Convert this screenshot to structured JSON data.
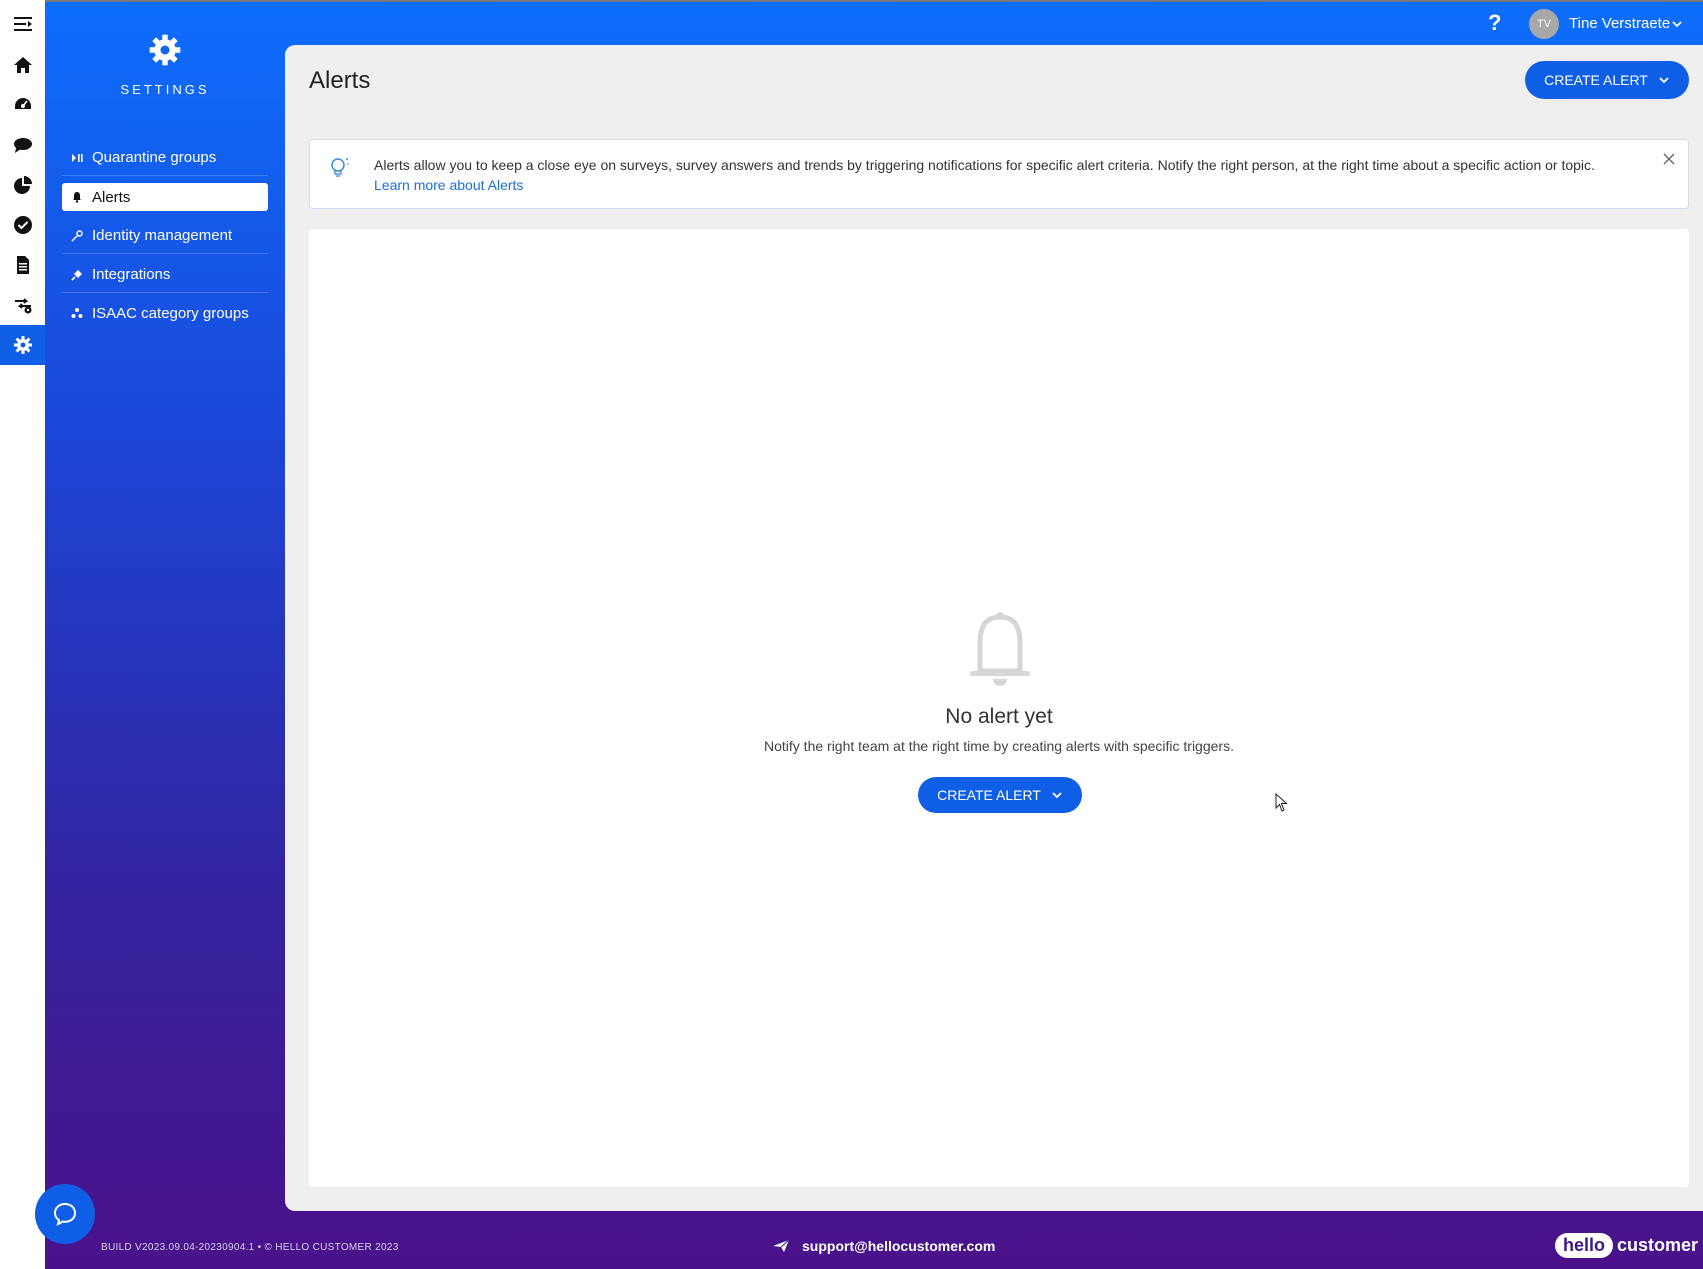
{
  "app": {
    "section_title": "SETTINGS"
  },
  "rail": {
    "items": [
      "menu-toggle",
      "home",
      "dashboard",
      "conversations",
      "reports",
      "tasks",
      "documents",
      "workflow",
      "settings"
    ]
  },
  "sidebar": {
    "items": [
      {
        "label": "Quarantine groups",
        "icon": "pause-play-icon"
      },
      {
        "label": "Alerts",
        "icon": "bell-icon",
        "active": true
      },
      {
        "label": "Identity management",
        "icon": "key-icon"
      },
      {
        "label": "Integrations",
        "icon": "plug-icon"
      },
      {
        "label": "ISAAC category groups",
        "icon": "group-icon"
      }
    ]
  },
  "header": {
    "help": "?",
    "avatar_initials": "TV",
    "user_name": "Tine Verstraete"
  },
  "main": {
    "title": "Alerts",
    "create_label": "CREATE ALERT",
    "banner": {
      "text": "Alerts allow you to keep a close eye on surveys, survey answers and trends by triggering notifications for specific alert criteria. Notify the right person, at the right time about a specific action or topic.",
      "link": "Learn more about Alerts"
    },
    "empty": {
      "title": "No alert yet",
      "subtitle": "Notify the right team at the right time by creating alerts with specific triggers.",
      "button_label": "CREATE ALERT"
    }
  },
  "footer": {
    "build": "BUILD V2023.09.04-20230904.1 • © HELLO CUSTOMER 2023",
    "support_email": "support@hellocustomer.com",
    "logo_hello": "hello",
    "logo_customer": "customer"
  },
  "colors": {
    "primary": "#0f5fe6",
    "gradient_top": "#0d6efd",
    "gradient_bottom": "#4a128a",
    "panel_bg": "#efefef"
  }
}
